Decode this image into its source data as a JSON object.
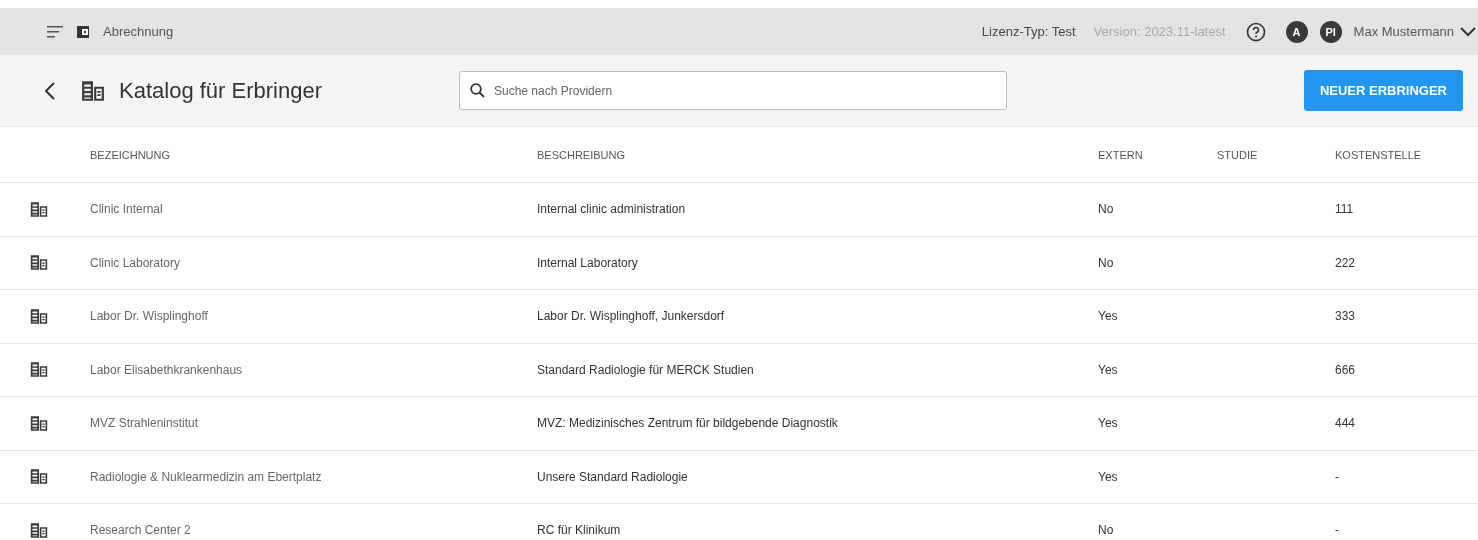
{
  "topbar": {
    "app_title": "Abrechnung",
    "license": "Lizenz-Typ: Test",
    "version": "Version: 2023.11-latest",
    "avatars": [
      "A",
      "PI"
    ],
    "user": "Max Mustermann"
  },
  "header": {
    "title": "Katalog für Erbringer",
    "search": {
      "placeholder": "Suche nach Providern"
    },
    "button": "NEUER ERBRINGER"
  },
  "table": {
    "columns": [
      "BEZEICHNUNG",
      "BESCHREIBUNG",
      "EXTERN",
      "STUDIE",
      "KOSTENSTELLE"
    ],
    "rows": [
      {
        "name": "Clinic Internal",
        "description": "Internal clinic administration",
        "extern": "No",
        "kostenstelle": "111"
      },
      {
        "name": "Clinic Laboratory",
        "description": "Internal Laboratory",
        "extern": "No",
        "kostenstelle": "222"
      },
      {
        "name": "Labor Dr. Wisplinghoff",
        "description": "Labor Dr. Wisplinghoff, Junkersdorf",
        "extern": "Yes",
        "kostenstelle": "333"
      },
      {
        "name": "Labor Elisabethkrankenhaus",
        "description": "Standard Radiologie für MERCK Studien",
        "extern": "Yes",
        "kostenstelle": "666"
      },
      {
        "name": "MVZ Strahleninstitut",
        "description": "MVZ: Medizinisches Zentrum für bildgebende Diagnostik",
        "extern": "Yes",
        "kostenstelle": "444"
      },
      {
        "name": "Radiologie & Nuklearmedizin am Ebertplatz",
        "description": "Unsere Standard Radiologie",
        "extern": "Yes",
        "kostenstelle": "-"
      },
      {
        "name": "Research Center 2",
        "description": "RC für Klinikum",
        "extern": "No",
        "kostenstelle": "-"
      }
    ]
  }
}
